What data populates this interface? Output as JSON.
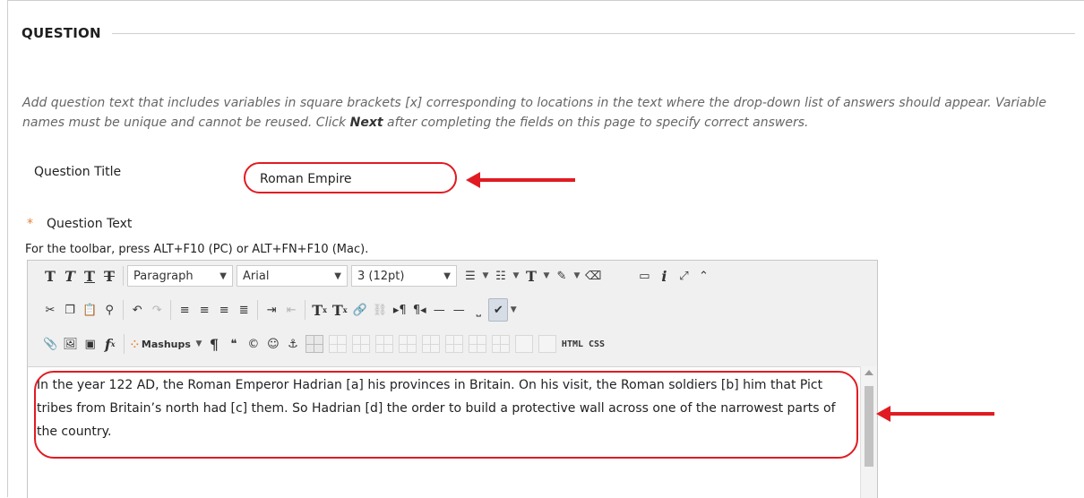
{
  "section": {
    "title": "QUESTION"
  },
  "instructions": {
    "before": "Add question text that includes variables in square brackets [x] corresponding to locations in the text where the drop-down list of answers should appear. Variable names must be unique and cannot be reused. Click ",
    "bold": "Next",
    "after": " after completing the fields on this page to specify correct answers."
  },
  "question_title": {
    "label": "Question Title",
    "value": "Roman Empire"
  },
  "question_text": {
    "required_marker": "*",
    "label": "Question Text",
    "toolbar_hint": "For the toolbar, press ALT+F10 (PC) or ALT+FN+F10 (Mac).",
    "content": "In the year 122 AD, the Roman Emperor Hadrian [a] his provinces in Britain. On his visit, the Roman soldiers [b] him that Pict tribes from Britain’s north had [c] them. So Hadrian [d] the order to build a protective wall across one of the narrowest parts of the country."
  },
  "toolbar": {
    "format_select": "Paragraph",
    "font_select": "Arial",
    "size_select": "3 (12pt)",
    "bold_glyph": "T",
    "italic_glyph": "T",
    "underline_glyph": "T",
    "strike_glyph": "T",
    "text_color_glyph": "T",
    "superscript_glyph": "T",
    "subscript_glyph": "T",
    "info_glyph": "i",
    "formula_glyph": "f",
    "mashups_label": "Mashups",
    "html_label": "HTML",
    "css_label": "CSS",
    "pilcrow": "¶",
    "quote": "❝",
    "copyright": "©"
  },
  "colors": {
    "accent_red": "#e11b22",
    "required_orange": "#e0833f",
    "instructions_gray": "#666666"
  }
}
